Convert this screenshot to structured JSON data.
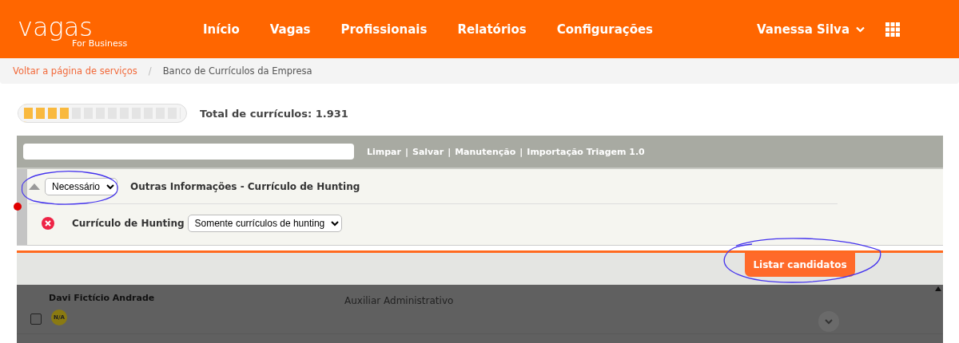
{
  "header": {
    "logo": "vagas",
    "logo_sub": "For Business",
    "nav": [
      {
        "label": "Início"
      },
      {
        "label": "Vagas"
      },
      {
        "label": "Profissionais"
      },
      {
        "label": "Relatórios"
      },
      {
        "label": "Configurações"
      }
    ],
    "user": "Vanessa Silva"
  },
  "breadcrumb": [
    {
      "label": "Voltar a página de serviços",
      "kind": "link"
    },
    {
      "label": "/",
      "kind": "separator"
    },
    {
      "label": "Banco de Currículos da Empresa",
      "kind": "current"
    }
  ],
  "meter": {
    "level": 0.3
  },
  "total": "Total de currículos: 1.931",
  "toolbar": {
    "links": [
      {
        "label": "Limpar"
      },
      {
        "label": "Salvar"
      },
      {
        "label": "Manutenção"
      },
      {
        "label": "Importação Triagem 1.0"
      }
    ],
    "separator": "|"
  },
  "filter": {
    "requirement": "Necessário",
    "title": "Outras Informações - Currículo de Hunting",
    "criteria": [
      {
        "label": "Currículo de Hunting",
        "value": "Somente currículos de hunting"
      }
    ]
  },
  "list_button": "Listar candidatos",
  "results": [
    {
      "name": "Davi Fictício Andrade",
      "badge": "N/A",
      "position": "Auxiliar Administrativo",
      "checked": false
    }
  ]
}
